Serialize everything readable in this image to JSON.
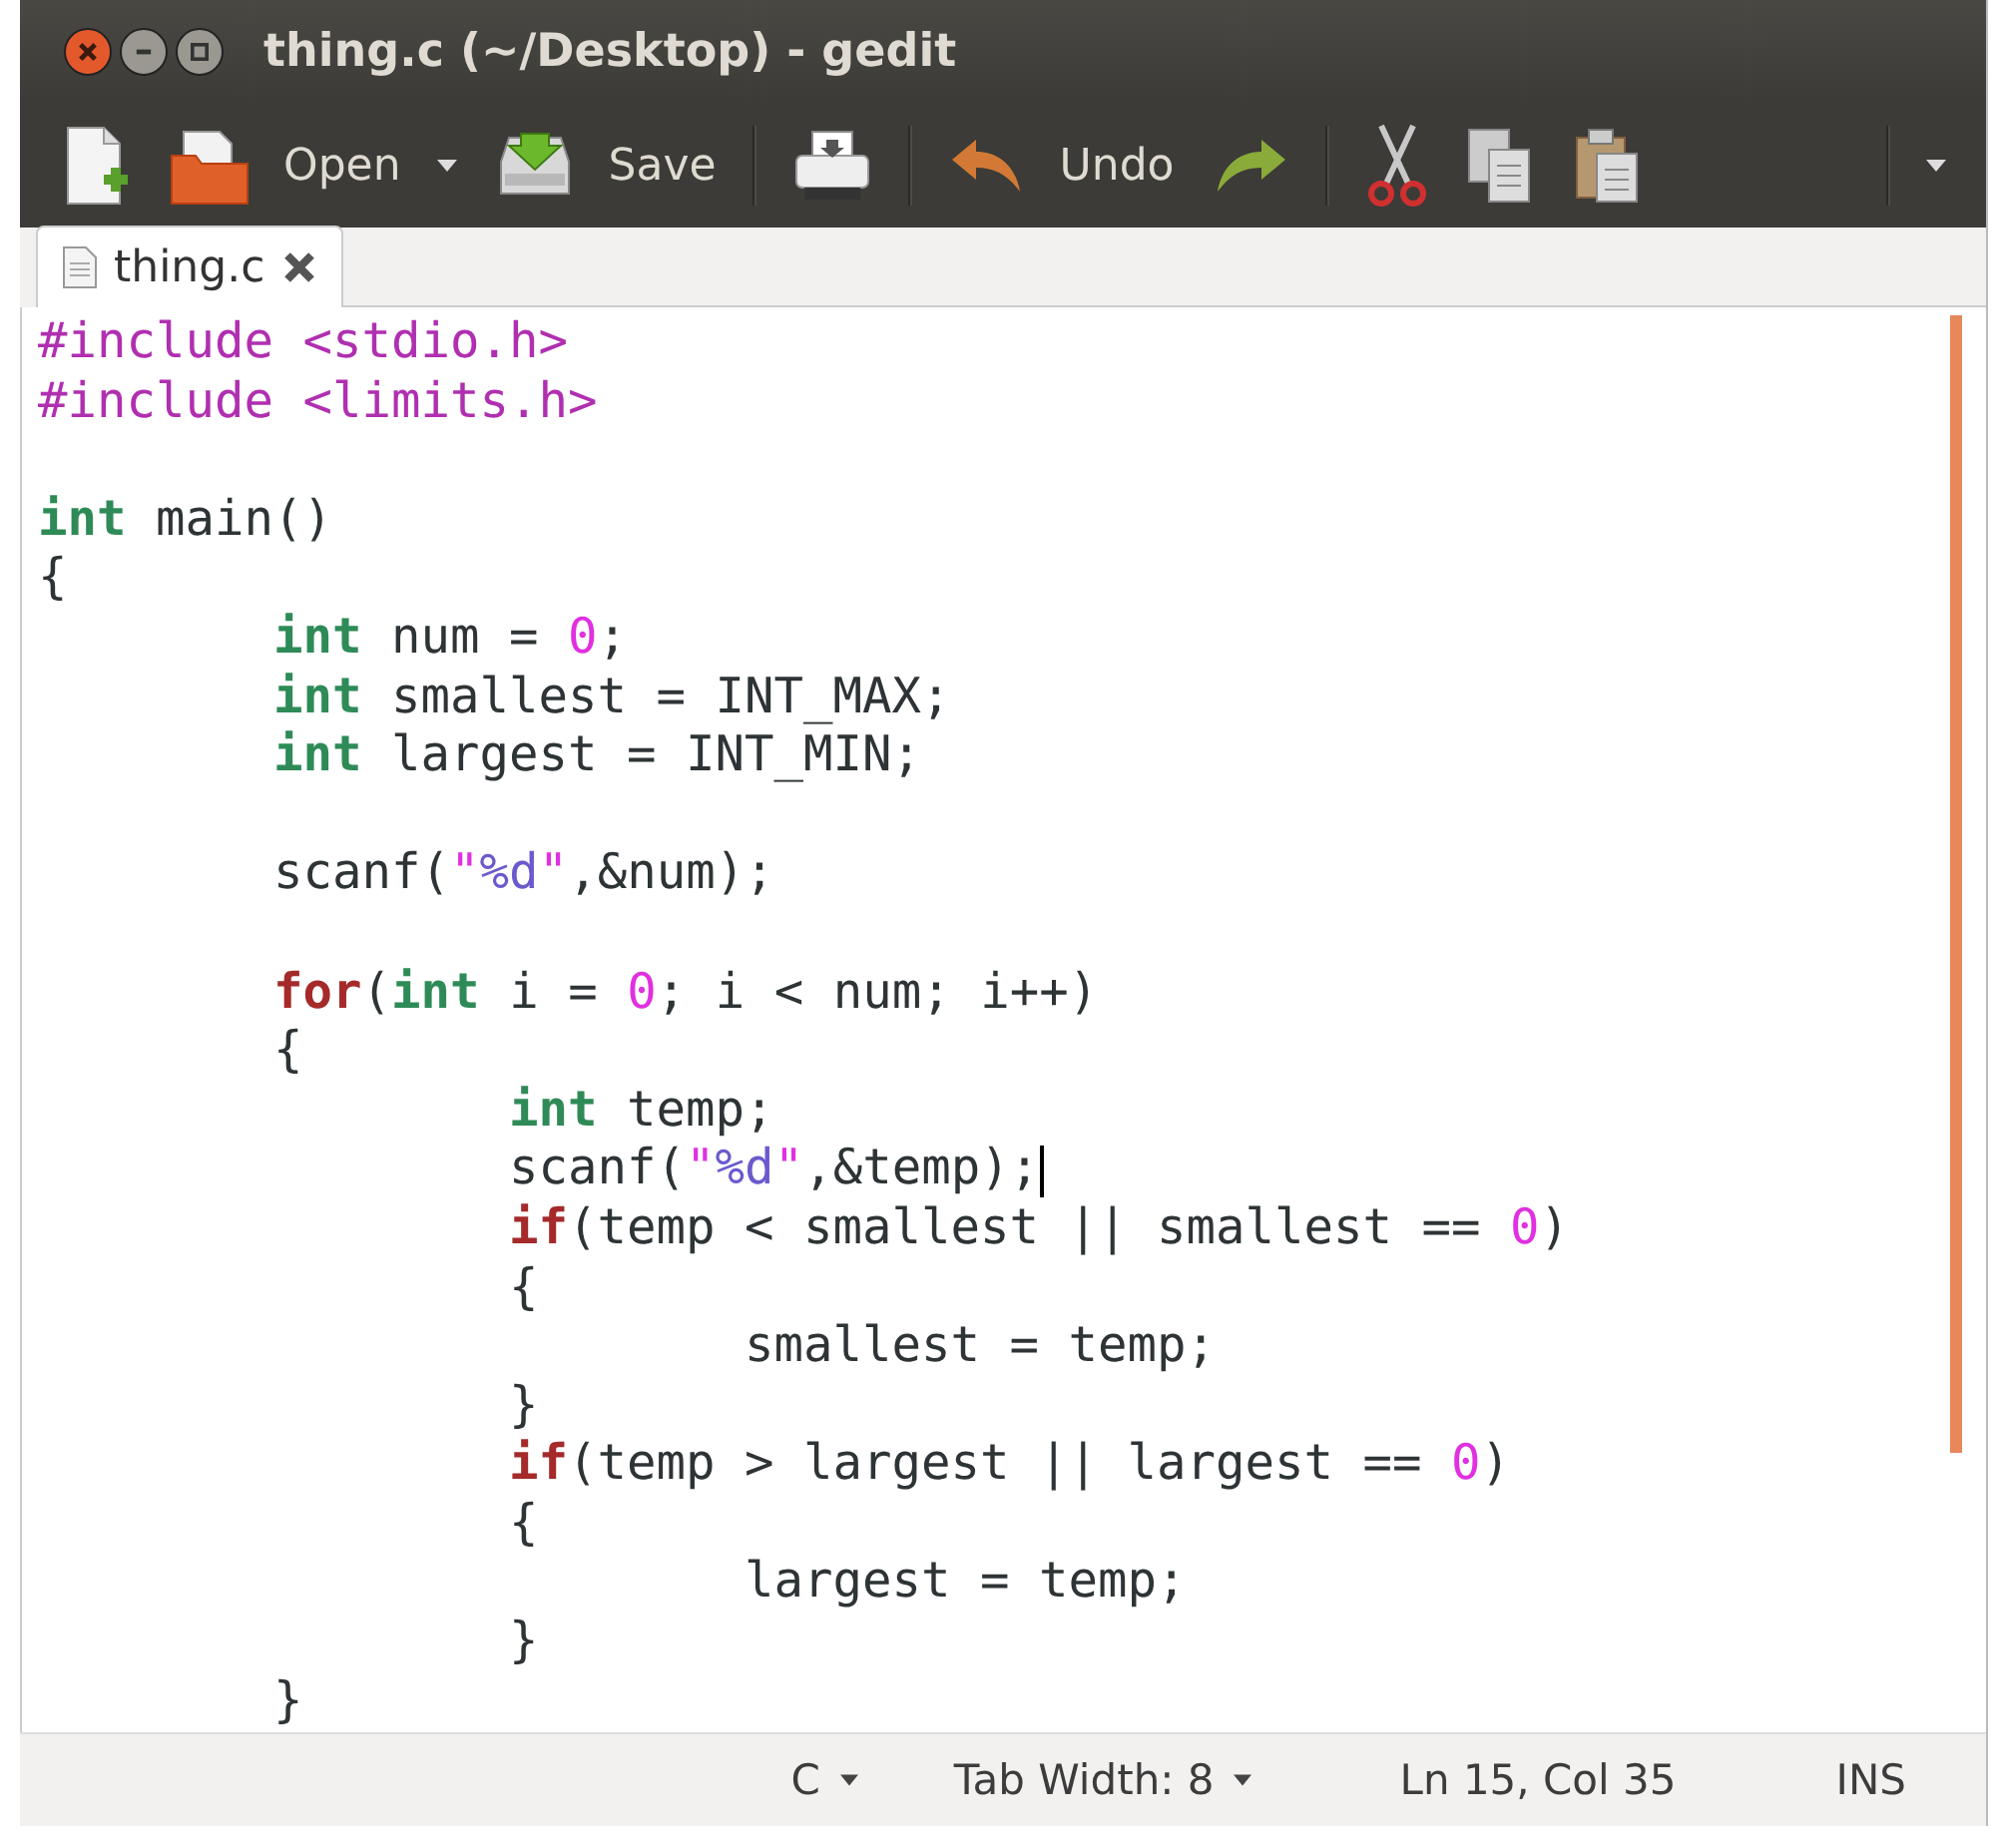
{
  "window": {
    "title": "thing.c (~/Desktop) - gedit"
  },
  "toolbar": [
    {
      "kind": "new"
    },
    {
      "kind": "open",
      "label": "Open",
      "dropdown": true
    },
    {
      "kind": "save",
      "label": "Save"
    },
    {
      "kind": "print"
    },
    {
      "kind": "undo",
      "label": "Undo"
    },
    {
      "kind": "redo"
    },
    {
      "kind": "cut"
    },
    {
      "kind": "copy"
    },
    {
      "kind": "paste"
    }
  ],
  "tabs": [
    {
      "label": "thing.c",
      "selected": true
    }
  ],
  "code": [
    {
      "cursor": false,
      "tokens": [
        {
          "kind": "preproc",
          "text": "#include <stdio.h>"
        }
      ]
    },
    {
      "cursor": false,
      "tokens": [
        {
          "kind": "preproc",
          "text": "#include <limits.h>"
        }
      ]
    },
    {
      "kind": "blank"
    },
    {
      "cursor": false,
      "tokens": [
        {
          "kind": "type",
          "text": "int"
        },
        {
          "kind": "plain",
          "text": " main()"
        }
      ]
    },
    {
      "cursor": false,
      "tokens": [
        {
          "kind": "plain",
          "text": "{"
        }
      ]
    },
    {
      "cursor": false,
      "tokens": [
        {
          "kind": "type",
          "text": "\tint"
        },
        {
          "kind": "plain",
          "text": " num = "
        },
        {
          "kind": "number",
          "text": "0"
        },
        {
          "kind": "plain",
          "text": ";"
        }
      ]
    },
    {
      "cursor": false,
      "tokens": [
        {
          "kind": "type",
          "text": "\tint"
        },
        {
          "kind": "plain",
          "text": " smallest = INT_MAX;"
        }
      ]
    },
    {
      "cursor": false,
      "tokens": [
        {
          "kind": "type",
          "text": "\tint"
        },
        {
          "kind": "plain",
          "text": " largest = INT_MIN;"
        }
      ]
    },
    {
      "kind": "blank"
    },
    {
      "cursor": false,
      "tokens": [
        {
          "kind": "plain",
          "text": "\tscanf("
        },
        {
          "kind": "string",
          "text": "\""
        },
        {
          "kind": "format",
          "text": "%d"
        },
        {
          "kind": "string",
          "text": "\""
        },
        {
          "kind": "plain",
          "text": ",&num);"
        }
      ]
    },
    {
      "kind": "blank"
    },
    {
      "cursor": false,
      "tokens": [
        {
          "kind": "keyword",
          "text": "\tfor"
        },
        {
          "kind": "plain",
          "text": "("
        },
        {
          "kind": "type",
          "text": "int"
        },
        {
          "kind": "plain",
          "text": " i = "
        },
        {
          "kind": "number",
          "text": "0"
        },
        {
          "kind": "plain",
          "text": "; i < num; i++)"
        }
      ]
    },
    {
      "cursor": false,
      "tokens": [
        {
          "kind": "plain",
          "text": "\t{"
        }
      ]
    },
    {
      "cursor": false,
      "tokens": [
        {
          "kind": "type",
          "text": "\t\tint"
        },
        {
          "kind": "plain",
          "text": " temp;"
        }
      ]
    },
    {
      "cursor": true,
      "tokens": [
        {
          "kind": "plain",
          "text": "\t\tscanf("
        },
        {
          "kind": "string",
          "text": "\""
        },
        {
          "kind": "format",
          "text": "%d"
        },
        {
          "kind": "string",
          "text": "\""
        },
        {
          "kind": "plain",
          "text": ",&temp);"
        }
      ]
    },
    {
      "cursor": false,
      "tokens": [
        {
          "kind": "keyword",
          "text": "\t\tif"
        },
        {
          "kind": "plain",
          "text": "(temp < smallest || smallest == "
        },
        {
          "kind": "number",
          "text": "0"
        },
        {
          "kind": "plain",
          "text": ")"
        }
      ]
    },
    {
      "cursor": false,
      "tokens": [
        {
          "kind": "plain",
          "text": "\t\t{"
        }
      ]
    },
    {
      "cursor": false,
      "tokens": [
        {
          "kind": "plain",
          "text": "\t\t\tsmallest = temp;"
        }
      ]
    },
    {
      "cursor": false,
      "tokens": [
        {
          "kind": "plain",
          "text": "\t\t}"
        }
      ]
    },
    {
      "cursor": false,
      "tokens": [
        {
          "kind": "keyword",
          "text": "\t\tif"
        },
        {
          "kind": "plain",
          "text": "(temp > largest || largest == "
        },
        {
          "kind": "number",
          "text": "0"
        },
        {
          "kind": "plain",
          "text": ")"
        }
      ]
    },
    {
      "cursor": false,
      "tokens": [
        {
          "kind": "plain",
          "text": "\t\t{"
        }
      ]
    },
    {
      "cursor": false,
      "tokens": [
        {
          "kind": "plain",
          "text": "\t\t\tlargest = temp;"
        }
      ]
    },
    {
      "cursor": false,
      "tokens": [
        {
          "kind": "plain",
          "text": "\t\t}"
        }
      ]
    },
    {
      "cursor": false,
      "tokens": [
        {
          "kind": "plain",
          "text": "\t}"
        }
      ]
    }
  ],
  "status_bar": {
    "language": "C",
    "tab_width": "Tab Width: 8",
    "position": "Ln 15, Col 35",
    "mode": "INS"
  }
}
